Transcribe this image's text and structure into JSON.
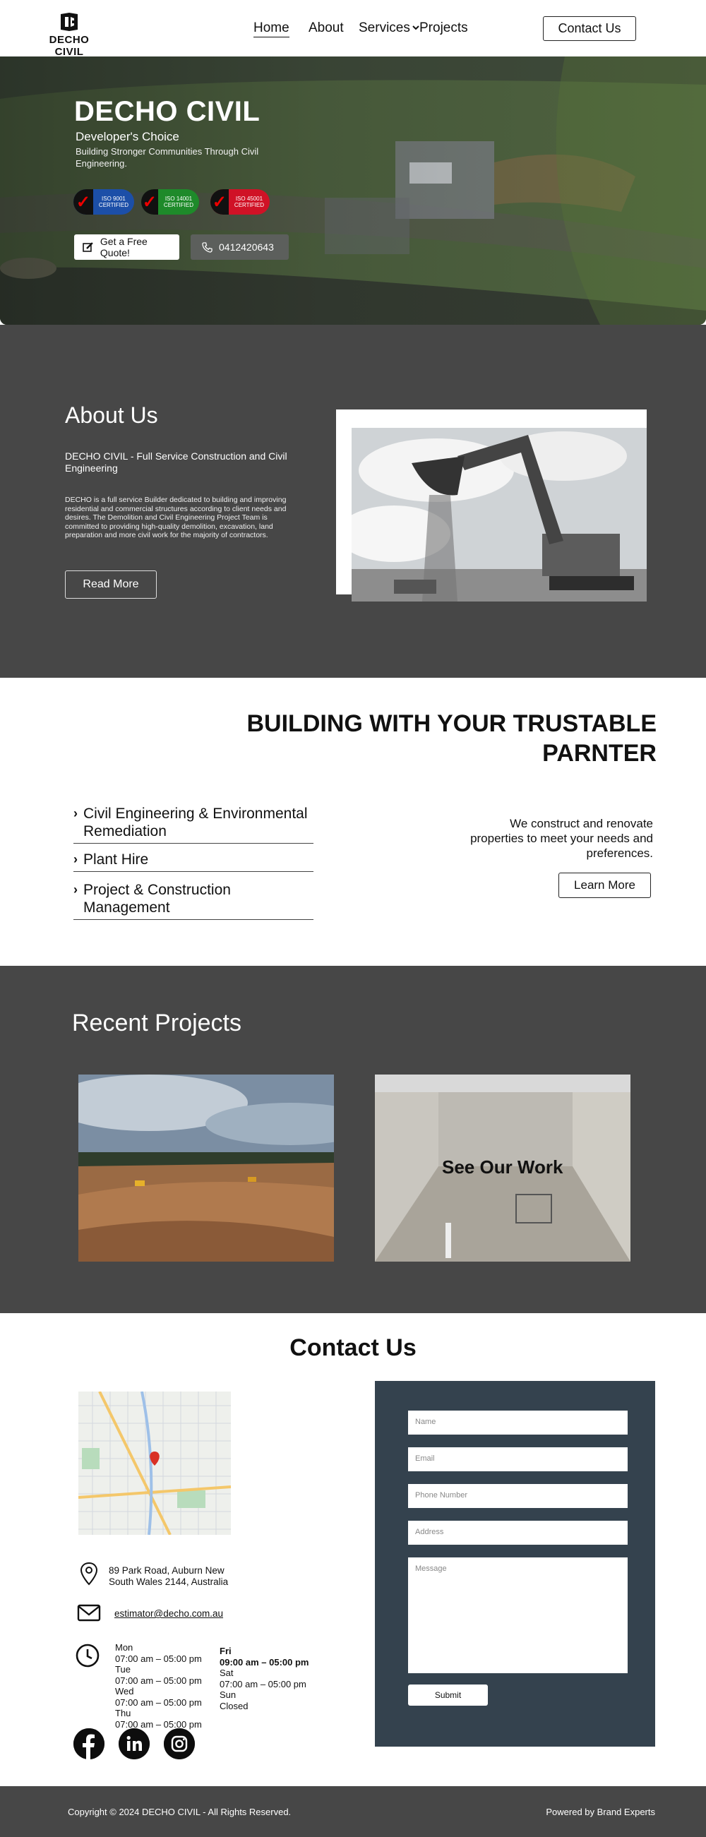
{
  "brand": {
    "name": "DECHO CIVIL"
  },
  "nav": {
    "items": [
      {
        "label": "Home",
        "active": true
      },
      {
        "label": "About"
      },
      {
        "label": "Services",
        "has_dropdown": true
      },
      {
        "label": "Projects"
      }
    ],
    "contact_button": "Contact Us"
  },
  "hero": {
    "title": "DECHO CIVIL",
    "subtitle": "Developer's Choice",
    "description": "Building Stronger Communities Through Civil Engineering.",
    "badges": [
      {
        "label": "ISO 9001",
        "sub": "CERTIFIED",
        "color": "#1c4fa8"
      },
      {
        "label": "ISO 14001",
        "sub": "CERTIFIED",
        "color": "#1e8a2a"
      },
      {
        "label": "ISO 45001",
        "sub": "CERTIFIED",
        "color": "#d01226"
      }
    ],
    "quote_button": "Get a Free Quote!",
    "phone_button": "0412420643"
  },
  "about": {
    "title": "About Us",
    "tagline": "DECHO CIVIL - Full Service Construction and Civil Engineering",
    "description": "DECHO is a full service Builder dedicated to building and improving residential and commercial structures according to client needs and desires. The Demolition and Civil Engineering Project Team is committed to providing high-quality demolition, excavation, land preparation and more civil work for the majority of contractors.",
    "read_more": "Read More"
  },
  "services": {
    "title": "BUILDING WITH YOUR TRUSTABLE PARNTER",
    "items": [
      {
        "label": "Civil Engineering & Environmental Remediation"
      },
      {
        "label": "Plant Hire"
      },
      {
        "label": "Project & Construction Management"
      }
    ],
    "blurb": "We construct and renovate properties to meet your needs and preferences.",
    "learn_more": "Learn More"
  },
  "projects": {
    "title": "Recent Projects",
    "see_work": "See Our Work"
  },
  "contact": {
    "title": "Contact Us",
    "address": "89 Park Road, Auburn New South Wales 2144, Australia",
    "email": "estimator@decho.com.au",
    "hours_left": [
      {
        "day": "Mon",
        "time": "07:00 am – 05:00 pm"
      },
      {
        "day": "Tue",
        "time": "07:00 am – 05:00 pm"
      },
      {
        "day": "Wed",
        "time": "07:00 am – 05:00 pm"
      },
      {
        "day": "Thu",
        "time": "07:00 am – 05:00 pm"
      }
    ],
    "hours_right": [
      {
        "day": "Fri",
        "time": "09:00 am – 05:00 pm"
      },
      {
        "day": "Sat",
        "time": "07:00 am – 05:00 pm"
      },
      {
        "day": "Sun",
        "time": "Closed"
      }
    ],
    "form": {
      "name_placeholder": "Name",
      "email_placeholder": "Email",
      "phone_placeholder": "Phone Number",
      "address_placeholder": "Address",
      "message_placeholder": "Message",
      "submit": "Submit"
    }
  },
  "footer": {
    "copyright": "Copyright © 2024 DECHO CIVIL - All Rights Reserved.",
    "powered": "Powered by Brand Experts"
  }
}
